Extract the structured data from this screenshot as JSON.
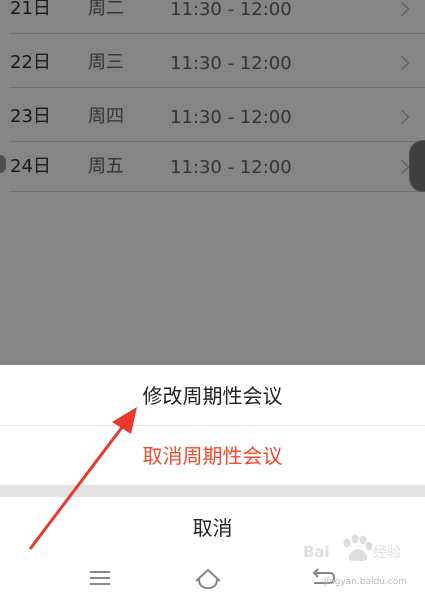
{
  "schedule": {
    "rows": [
      {
        "date": "21日",
        "weekday": "周二",
        "time": "11:30 - 12:00"
      },
      {
        "date": "22日",
        "weekday": "周三",
        "time": "11:30 - 12:00"
      },
      {
        "date": "23日",
        "weekday": "周四",
        "time": "11:30 - 12:00"
      },
      {
        "date": "24日",
        "weekday": "周五",
        "time": "11:30 - 12:00"
      }
    ]
  },
  "action_sheet": {
    "modify_label": "修改周期性会议",
    "cancel_periodic_label": "取消周期性会议",
    "cancel_label": "取消"
  },
  "navbar": {
    "menu_icon": "menu-icon",
    "home_icon": "home-icon",
    "back_icon": "back-icon"
  },
  "watermark": {
    "url": "jingyan.baidu.com"
  },
  "colors": {
    "destructive": "#f04b2f",
    "overlay": "rgba(0,0,0,0.48)"
  }
}
